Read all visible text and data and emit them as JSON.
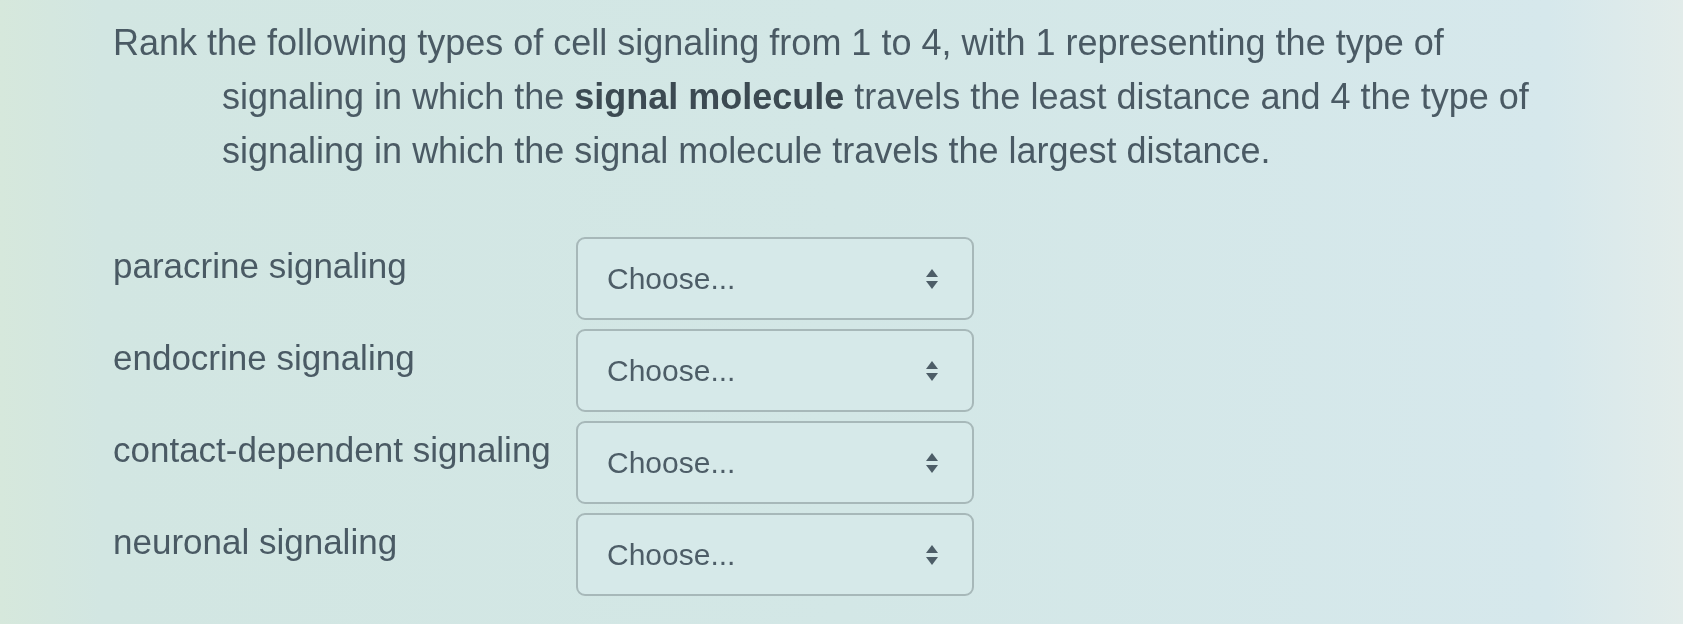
{
  "question": "Rank the following types of cell signaling from 1 to 4, with 1 representing the type of signaling in which the **signal molecule** travels the least distance and 4 the type of signaling in which the signal molecule travels the largest distance.",
  "items": [
    {
      "label": "paracrine signaling",
      "dropdown": {
        "value": "Choose..."
      }
    },
    {
      "label": "endocrine signaling",
      "dropdown": {
        "value": "Choose..."
      }
    },
    {
      "label": "contact-dependent signaling",
      "dropdown": {
        "value": "Choose..."
      }
    },
    {
      "label": "neuronal signaling",
      "dropdown": {
        "value": "Choose..."
      }
    }
  ]
}
